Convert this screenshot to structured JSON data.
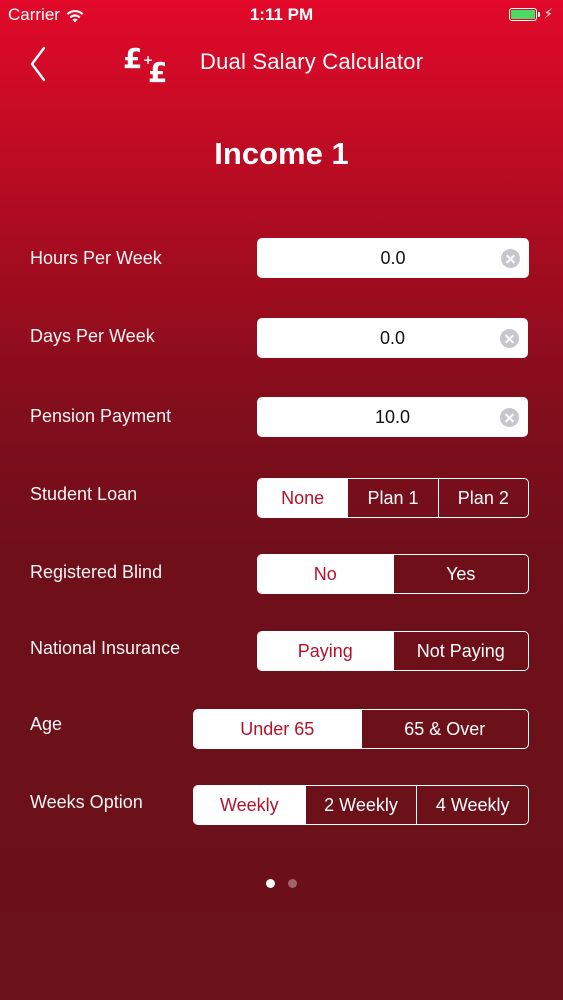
{
  "status_bar": {
    "carrier": "Carrier",
    "time": "1:11 PM",
    "battery_level": 1.0,
    "battery_color": "#4cd964"
  },
  "nav": {
    "back_icon": "chevron-left-icon",
    "logo_icon": "pound-pound-logo",
    "title": "Dual Salary Calculator"
  },
  "page_title": "Income 1",
  "form": {
    "hours_per_week": {
      "label": "Hours Per Week",
      "value": "0.0"
    },
    "days_per_week": {
      "label": "Days Per Week",
      "value": "0.0"
    },
    "pension_payment": {
      "label": "Pension Payment",
      "value": "10.0"
    },
    "student_loan": {
      "label": "Student Loan",
      "options": [
        "None",
        "Plan 1",
        "Plan 2"
      ],
      "selected": "None"
    },
    "registered_blind": {
      "label": "Registered Blind",
      "options": [
        "No",
        "Yes"
      ],
      "selected": "No"
    },
    "national_insurance": {
      "label": "National Insurance",
      "options": [
        "Paying",
        "Not Paying"
      ],
      "selected": "Paying"
    },
    "age": {
      "label": "Age",
      "options": [
        "Under 65",
        "65 & Over"
      ],
      "selected": "Under 65"
    },
    "weeks_option": {
      "label": "Weeks Option",
      "options": [
        "Weekly",
        "2 Weekly",
        "4 Weekly"
      ],
      "selected": "Weekly"
    }
  },
  "pager": {
    "pages": 2,
    "current": 1
  },
  "colors": {
    "accent": "#b4122a",
    "background_top": "#e2092a",
    "background_bottom": "#6a111a"
  }
}
